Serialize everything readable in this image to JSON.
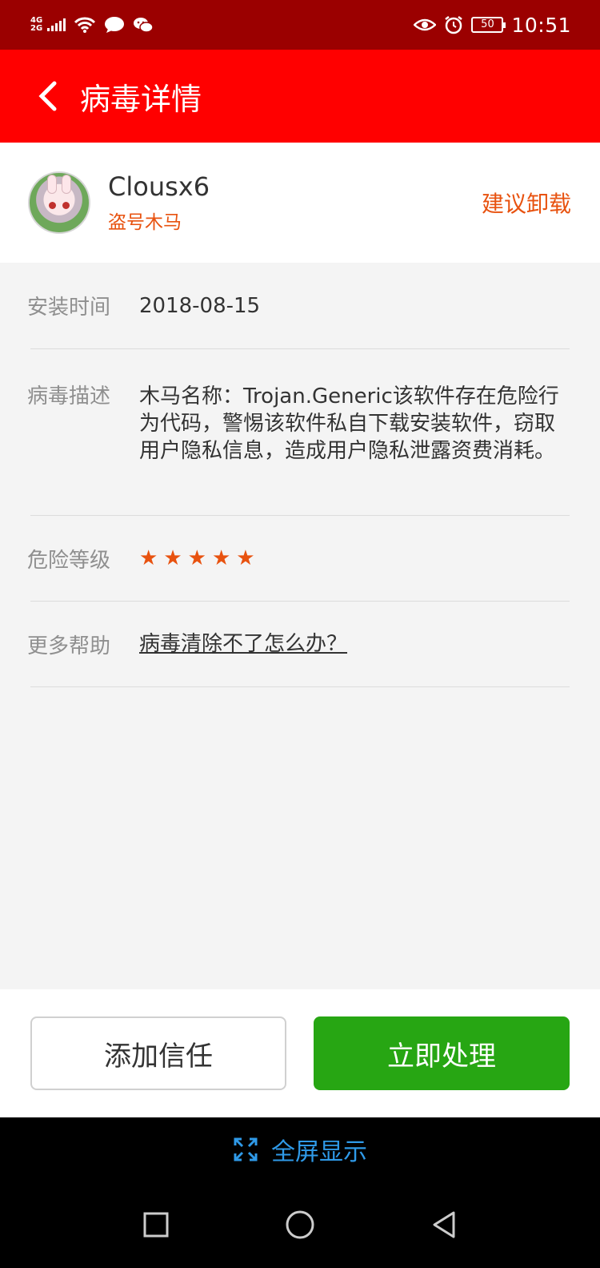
{
  "status_bar": {
    "network": [
      "4G",
      "2G"
    ],
    "battery": "50",
    "time": "10:51"
  },
  "app_bar": {
    "title": "病毒详情"
  },
  "app": {
    "name": "Clousx6",
    "type": "盗号木马",
    "action": "建议卸载"
  },
  "details": {
    "install_time_label": "安装时间",
    "install_time": "2018-08-15",
    "description_label": "病毒描述",
    "description": "木马名称：Trojan.Generic该软件存在危险行为代码，警惕该软件私自下载安装软件，窃取用户隐私信息，造成用户隐私泄露资费消耗。",
    "danger_label": "危险等级",
    "danger_level": 5,
    "help_label": "更多帮助",
    "help_link": "病毒清除不了怎么办？"
  },
  "buttons": {
    "trust": "添加信任",
    "handle": "立即处理"
  },
  "fullscreen": {
    "label": "全屏显示"
  },
  "colors": {
    "status_bar": "#9b0000",
    "app_bar": "#ff0000",
    "accent": "#e8520f",
    "primary_button": "#27a613",
    "link": "#2f9ae8"
  }
}
